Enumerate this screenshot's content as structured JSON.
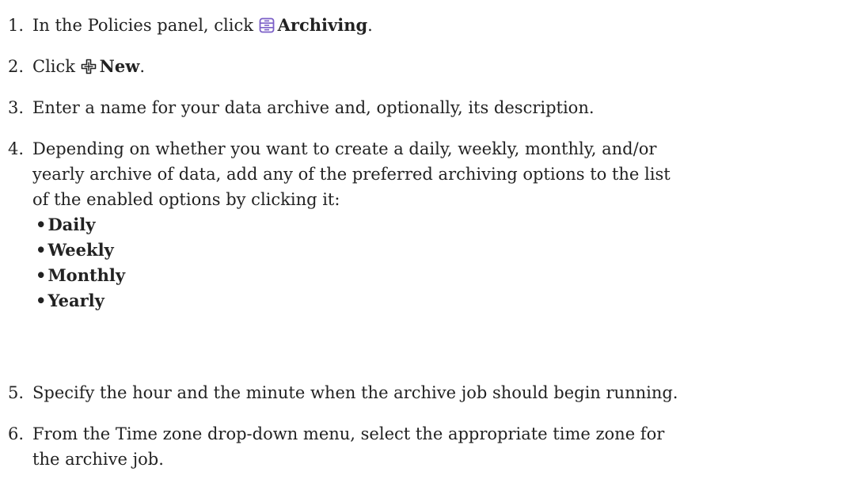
{
  "steps": [
    {
      "number": "1.",
      "pre": "In the Policies panel, click ",
      "icon": "archive-list-icon",
      "bold": "Archiving",
      "post": "."
    },
    {
      "number": "2.",
      "pre": "Click ",
      "icon": "plus-outline-icon",
      "bold": "New",
      "post": "."
    },
    {
      "number": "3.",
      "text": "Enter a name for your data archive and, optionally, its description."
    },
    {
      "number": "4.",
      "lines": [
        "Depending on whether you want to create a daily, weekly, monthly, and/or",
        "yearly archive of data, add any of the preferred archiving options to the list",
        "of the enabled options by clicking it:"
      ],
      "bullet": "•",
      "options": [
        "Daily",
        "Weekly",
        "Monthly",
        "Yearly"
      ]
    },
    {
      "number": "5.",
      "text": "Specify the hour and the minute when the archive job should begin running."
    },
    {
      "number": "6.",
      "lines": [
        "From the Time zone drop-down menu, select the appropriate time zone for",
        "the archive job."
      ]
    }
  ],
  "colors": {
    "text": "#222222",
    "icon_purple": "#7b5fc7"
  }
}
